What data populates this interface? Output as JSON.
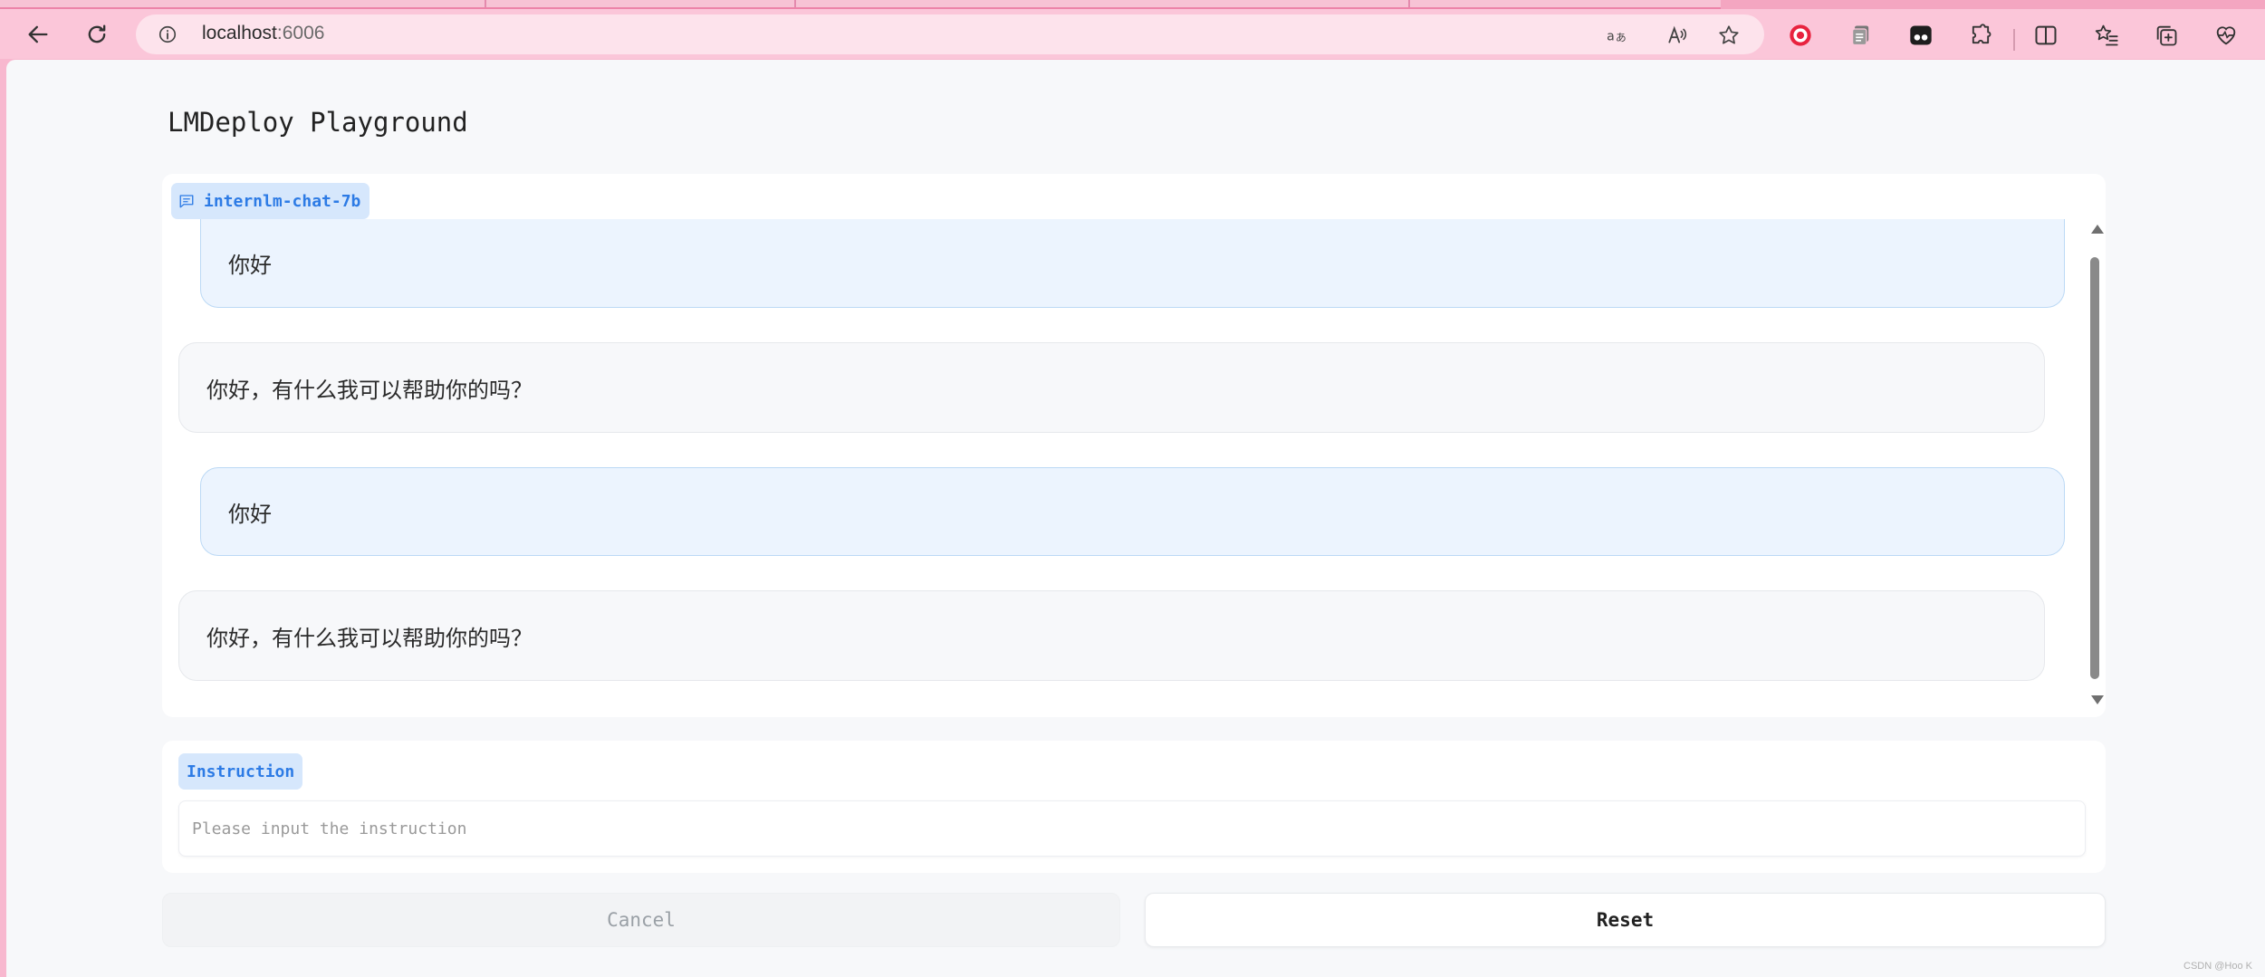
{
  "browser": {
    "url_host": "localhost",
    "url_port": ":6006"
  },
  "app": {
    "title": "LMDeploy Playground"
  },
  "chat": {
    "model_label": "internlm-chat-7b",
    "messages": [
      {
        "role": "user",
        "text": "你好"
      },
      {
        "role": "assistant",
        "text": "你好，有什么我可以帮助你的吗？"
      },
      {
        "role": "user",
        "text": "你好"
      },
      {
        "role": "assistant",
        "text": "你好，有什么我可以帮助你的吗？"
      }
    ]
  },
  "instruction": {
    "label": "Instruction",
    "placeholder": "Please input the instruction",
    "value": ""
  },
  "buttons": {
    "cancel": "Cancel",
    "reset": "Reset"
  },
  "watermark": "CSDN @Hoo K",
  "colors": {
    "browser_chrome": "#fbc6d9",
    "accent_blue": "#2d7be5",
    "label_bg": "#d6e7fc",
    "user_bubble": "#ecf4fe",
    "bot_bubble": "#f7f8fa"
  },
  "icons": {
    "back": "back-arrow-icon",
    "refresh": "refresh-icon",
    "site_info": "info-icon",
    "translate": "translate-icon",
    "read_aloud": "read-aloud-icon",
    "favorite": "star-icon",
    "chat": "chat-bubble-icon"
  }
}
